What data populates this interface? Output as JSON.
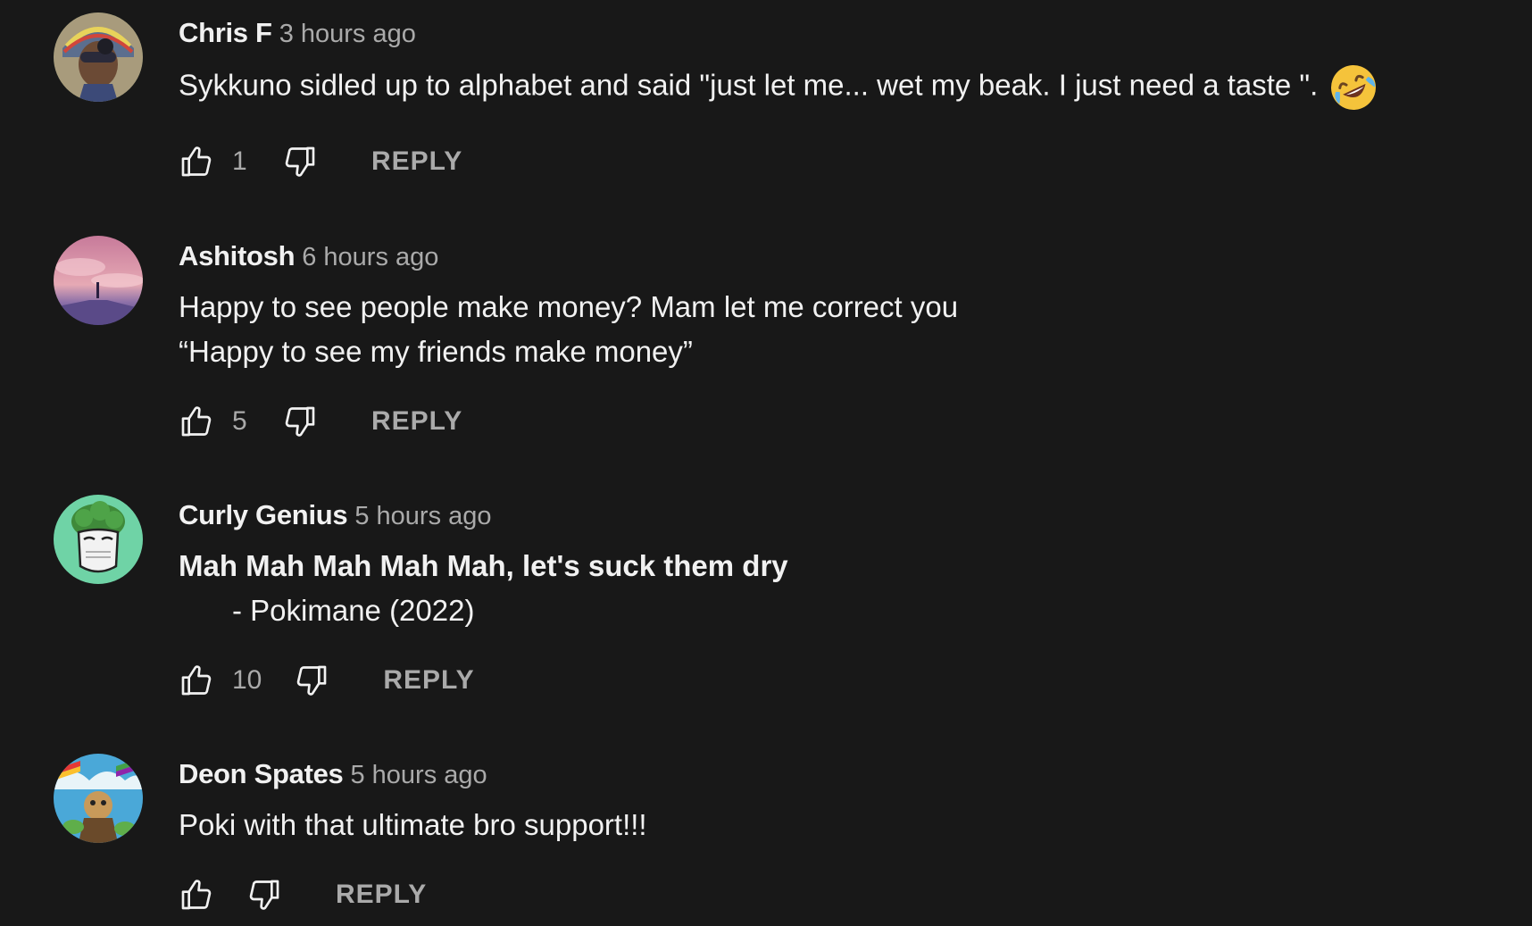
{
  "comments": [
    {
      "author": "Chris F",
      "time": "3 hours ago",
      "lines": [
        "Sykkuno sidled up to alphabet and said \"just let me... wet my beak. I just need a taste \"."
      ],
      "emoji": "rolling-on-floor-laughing-emoji",
      "likes": "1",
      "reply": "REPLY",
      "avatar": "avatar-chris-f"
    },
    {
      "author": "Ashitosh",
      "time": "6 hours ago",
      "lines": [
        "Happy to see people make money? Mam let me correct you",
        "“Happy to see my friends make money”"
      ],
      "likes": "5",
      "reply": "REPLY",
      "avatar": "avatar-ashitosh"
    },
    {
      "author": "Curly Genius",
      "time": "5 hours ago",
      "lines": [
        "Mah Mah Mah Mah Mah, let's suck them dry",
        "- Pokimane (2022)"
      ],
      "likes": "10",
      "reply": "REPLY",
      "avatar": "avatar-curly-genius"
    },
    {
      "author": "Deon Spates",
      "time": "5 hours ago",
      "lines": [
        "Poki with that ultimate bro support!!!"
      ],
      "likes": "",
      "reply": "REPLY",
      "avatar": "avatar-deon-spates"
    }
  ],
  "colors": {
    "background": "#181818",
    "primary_text": "#f1f1f1",
    "secondary_text": "#aaaaaa"
  }
}
